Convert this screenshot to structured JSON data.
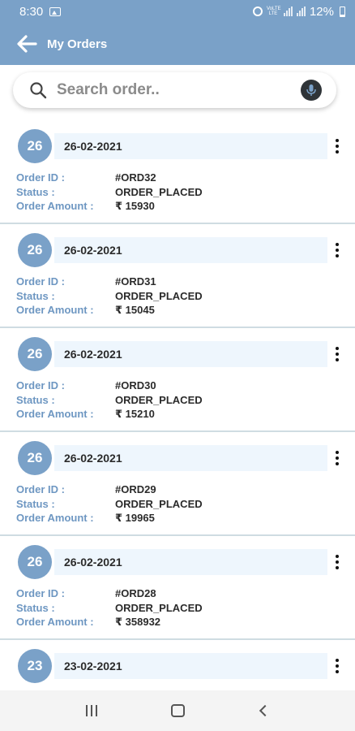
{
  "status_bar": {
    "time": "8:30",
    "network": "VoLTE LTE",
    "battery": "12%"
  },
  "app_bar": {
    "title": "My Orders"
  },
  "search": {
    "placeholder": "Search order.."
  },
  "labels": {
    "order_id": "Order ID :",
    "status": "Status :",
    "order_amount": "Order Amount :"
  },
  "orders": [
    {
      "day": "26",
      "date": "26-02-2021",
      "order_id": "#ORD32",
      "status": "ORDER_PLACED",
      "amount": "₹ 15930"
    },
    {
      "day": "26",
      "date": "26-02-2021",
      "order_id": "#ORD31",
      "status": "ORDER_PLACED",
      "amount": "₹ 15045"
    },
    {
      "day": "26",
      "date": "26-02-2021",
      "order_id": "#ORD30",
      "status": "ORDER_PLACED",
      "amount": "₹ 15210"
    },
    {
      "day": "26",
      "date": "26-02-2021",
      "order_id": "#ORD29",
      "status": "ORDER_PLACED",
      "amount": "₹ 19965"
    },
    {
      "day": "26",
      "date": "26-02-2021",
      "order_id": "#ORD28",
      "status": "ORDER_PLACED",
      "amount": "₹ 358932"
    },
    {
      "day": "23",
      "date": "23-02-2021"
    }
  ],
  "icons": {
    "back": "back-arrow-icon",
    "search": "search-icon",
    "mic": "mic-icon",
    "menu": "more-vertical-icon",
    "nav_recents": "recents-icon",
    "nav_home": "home-icon",
    "nav_back": "back-icon"
  },
  "colors": {
    "primary": "#7aa1c8",
    "label": "#6e97c2",
    "date_strip": "#eef6fd",
    "divider": "#cfdce2"
  }
}
